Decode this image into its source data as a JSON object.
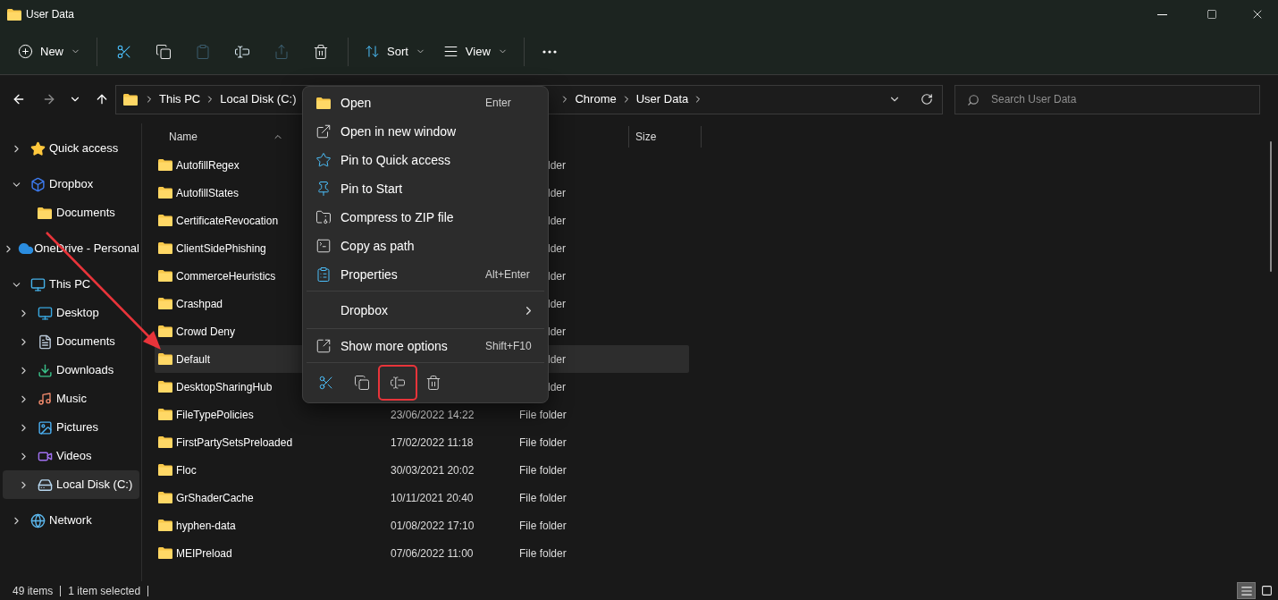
{
  "window": {
    "title": "User Data"
  },
  "toolbar": [
    {
      "kind": "dropdown",
      "label": "New"
    },
    {
      "kind": "separator"
    },
    {
      "kind": "icon",
      "disabled": false
    },
    {
      "kind": "icon",
      "disabled": false
    },
    {
      "kind": "icon",
      "disabled": true
    },
    {
      "kind": "icon",
      "disabled": false
    },
    {
      "kind": "icon",
      "disabled": true
    },
    {
      "kind": "icon",
      "disabled": false
    },
    {
      "kind": "separator"
    },
    {
      "kind": "dropdown",
      "label": "Sort"
    },
    {
      "kind": "dropdown",
      "label": "View"
    },
    {
      "kind": "separator"
    },
    {
      "kind": "more"
    }
  ],
  "nav": {
    "forward_disabled": true
  },
  "address": {
    "path_start": [
      "This PC",
      "Local Disk (C:)"
    ],
    "path_end": [
      "Chrome",
      "User Data"
    ]
  },
  "search": {
    "placeholder": "Search User Data"
  },
  "sidebar": {
    "items": [
      {
        "label": "Quick access",
        "expanded": false,
        "selected": false
      },
      {
        "label": "Dropbox",
        "expanded": true,
        "selected": false,
        "children": [
          {
            "label": "Documents",
            "selected": false
          }
        ]
      },
      {
        "label": "OneDrive - Personal",
        "expanded": false,
        "selected": false
      },
      {
        "label": "This PC",
        "expanded": true,
        "selected": false,
        "children": [
          {
            "label": "Desktop",
            "expanded": false,
            "selected": false
          },
          {
            "label": "Documents",
            "expanded": false,
            "selected": false
          },
          {
            "label": "Downloads",
            "expanded": false,
            "selected": false
          },
          {
            "label": "Music",
            "expanded": false,
            "selected": false
          },
          {
            "label": "Pictures",
            "expanded": false,
            "selected": false
          },
          {
            "label": "Videos",
            "expanded": false,
            "selected": false
          },
          {
            "label": "Local Disk (C:)",
            "expanded": false,
            "selected": true
          }
        ]
      },
      {
        "label": "Network",
        "expanded": false,
        "selected": false
      }
    ]
  },
  "table": {
    "columns": [
      "Name",
      "Size"
    ],
    "rows": [
      {
        "name": "AutofillRegex",
        "type": "lder",
        "selected": false
      },
      {
        "name": "AutofillStates",
        "type": "lder",
        "selected": false
      },
      {
        "name": "CertificateRevocation",
        "type": "lder",
        "selected": false
      },
      {
        "name": "ClientSidePhishing",
        "type": "lder",
        "selected": false
      },
      {
        "name": "CommerceHeuristics",
        "type": "lder",
        "selected": false
      },
      {
        "name": "Crashpad",
        "type": "lder",
        "selected": false
      },
      {
        "name": "Crowd Deny",
        "type": "lder",
        "selected": false
      },
      {
        "name": "Default",
        "type": "lder",
        "selected": true
      },
      {
        "name": "DesktopSharingHub",
        "type": "lder",
        "selected": false
      },
      {
        "name": "FileTypePolicies",
        "date": "23/06/2022 14:22",
        "type": "File folder",
        "selected": false
      },
      {
        "name": "FirstPartySetsPreloaded",
        "date": "17/02/2022 11:18",
        "type": "File folder",
        "selected": false
      },
      {
        "name": "Floc",
        "date": "30/03/2021 20:02",
        "type": "File folder",
        "selected": false
      },
      {
        "name": "GrShaderCache",
        "date": "10/11/2021 20:40",
        "type": "File folder",
        "selected": false
      },
      {
        "name": "hyphen-data",
        "date": "01/08/2022 17:10",
        "type": "File folder",
        "selected": false
      },
      {
        "name": "MEIPreload",
        "date": "07/06/2022 11:00",
        "type": "File folder",
        "selected": false
      }
    ]
  },
  "context_menu": {
    "groups": [
      [
        {
          "kind": "command",
          "label": "Open",
          "shortcut": "Enter"
        },
        {
          "kind": "command",
          "label": "Open in new window"
        },
        {
          "kind": "command",
          "label": "Pin to Quick access"
        },
        {
          "kind": "command",
          "label": "Pin to Start"
        },
        {
          "kind": "command",
          "label": "Compress to ZIP file"
        },
        {
          "kind": "command",
          "label": "Copy as path"
        },
        {
          "kind": "command",
          "label": "Properties",
          "shortcut": "Alt+Enter"
        }
      ],
      [
        {
          "kind": "submenu",
          "label": "Dropbox"
        }
      ],
      [
        {
          "kind": "command",
          "label": "Show more options",
          "shortcut": "Shift+F10"
        }
      ]
    ],
    "quick_actions": [
      {
        "highlighted": false
      },
      {
        "highlighted": false
      },
      {
        "highlighted": true
      },
      {
        "highlighted": false
      }
    ]
  },
  "status_bar": {
    "items": [
      "49 items",
      "1 item selected"
    ],
    "views": [
      {
        "selected": true
      },
      {
        "selected": false
      }
    ]
  }
}
